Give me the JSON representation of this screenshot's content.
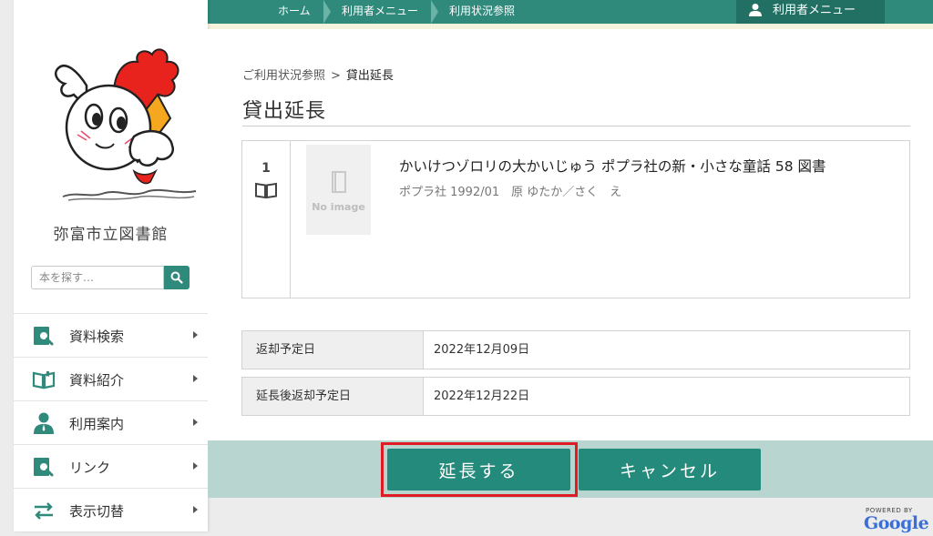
{
  "topnav": {
    "crumbs": [
      "ホーム",
      "利用者メニュー",
      "利用状況参照"
    ],
    "user_menu_label": "利用者メニュー"
  },
  "sidebar": {
    "library_name": "弥富市立図書館",
    "search_placeholder": "本を探す…",
    "items": [
      {
        "label": "資料検索",
        "icon": "search-doc-icon"
      },
      {
        "label": "資料紹介",
        "icon": "open-book-icon"
      },
      {
        "label": "利用案内",
        "icon": "person-icon"
      },
      {
        "label": "リンク",
        "icon": "link-doc-icon"
      },
      {
        "label": "表示切替",
        "icon": "switch-arrows-icon"
      }
    ]
  },
  "main": {
    "breadcrumb": {
      "parent": "ご利用状況参照",
      "separator": ">",
      "current": "貸出延長"
    },
    "title": "貸出延長",
    "book": {
      "number": "1",
      "cover_text": "No image",
      "title": "かいけつゾロリの大かいじゅう ポプラ社の新・小さな童話 58 図書",
      "meta": "ポプラ社 1992/01　原 ゆたか／さく　え"
    },
    "info": [
      {
        "label": "返却予定日",
        "value": "2022年12月09日"
      },
      {
        "label": "延長後返却予定日",
        "value": "2022年12月22日"
      }
    ],
    "buttons": {
      "extend": "延長する",
      "cancel": "キャンセル"
    }
  },
  "footer": {
    "powered_by": "POWERED BY",
    "google": "Google"
  },
  "colors": {
    "accent": "#2f8a7c",
    "button": "#248a7c",
    "button_bar": "#b8d5d0",
    "highlight": "#e01b24"
  }
}
